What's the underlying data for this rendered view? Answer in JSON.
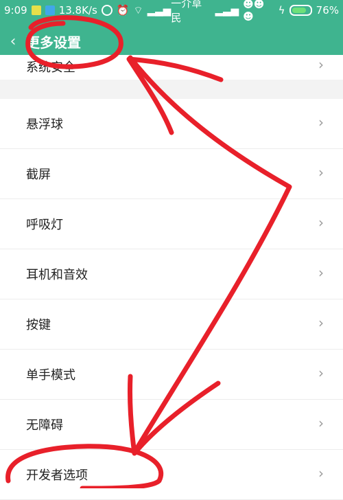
{
  "status_bar": {
    "time": "9:09",
    "speed": "13.8K/s",
    "carrier": "一介草民",
    "battery": "76%"
  },
  "header": {
    "back_icon": "chevron-left-icon",
    "title": "更多设置"
  },
  "top_item": {
    "label": "系统安全"
  },
  "items": [
    {
      "label": "悬浮球"
    },
    {
      "label": "截屏"
    },
    {
      "label": "呼吸灯"
    },
    {
      "label": "耳机和音效"
    },
    {
      "label": "按键"
    },
    {
      "label": "单手模式"
    },
    {
      "label": "无障碍"
    },
    {
      "label": "开发者选项"
    }
  ],
  "colors": {
    "header_bg": "#3fb48f",
    "annotation_red": "#e8202a"
  },
  "battery_level": 0.76
}
